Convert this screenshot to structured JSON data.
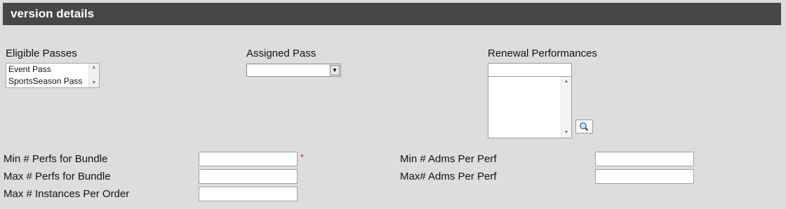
{
  "section": {
    "title": "version details"
  },
  "eligible_passes": {
    "label": "Eligible Passes",
    "options": [
      "Event Pass",
      "SportsSeason Pass"
    ]
  },
  "assigned_pass": {
    "label": "Assigned Pass",
    "value": ""
  },
  "renewal_performances": {
    "label": "Renewal Performances",
    "input_value": "",
    "search_icon": "magnifier-icon"
  },
  "bundle": {
    "min_perfs_label": "Min # Perfs for Bundle",
    "max_perfs_label": "Max # Perfs for Bundle",
    "max_instances_label": "Max # Instances Per Order",
    "required_marker": "*"
  },
  "admissions": {
    "min_adms_label": "Min # Adms Per Perf",
    "max_adms_label": "Max# Adms Per Perf"
  }
}
